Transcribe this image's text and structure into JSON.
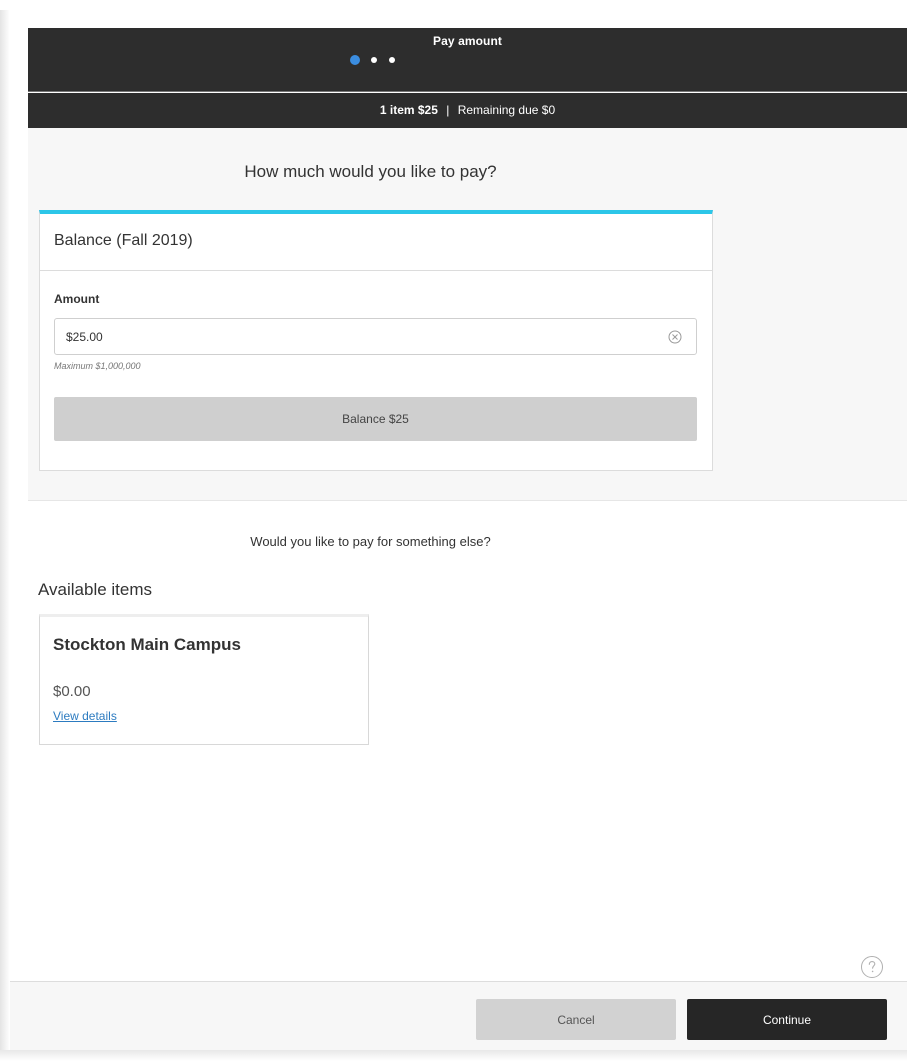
{
  "header": {
    "title": "Pay amount",
    "steps": {
      "current": 1,
      "total": 3
    }
  },
  "summary": {
    "items_bold": "1 item $25",
    "separator": "|",
    "remaining": "Remaining due $0"
  },
  "payment": {
    "question": "How much would you like to pay?",
    "card_title": "Balance (Fall 2019)",
    "amount_label": "Amount",
    "amount_value": "$25.00",
    "maximum_note": "Maximum $1,000,000",
    "balance_button_label": "Balance $25"
  },
  "other": {
    "question": "Would you like to pay for something else?",
    "available_title": "Available items",
    "items": [
      {
        "name": "Stockton Main Campus",
        "price": "$0.00",
        "link_label": "View details"
      }
    ]
  },
  "footer": {
    "cancel_label": "Cancel",
    "continue_label": "Continue"
  },
  "colors": {
    "accent": "#2cc6e8",
    "step_active": "#3b8de0",
    "header_bg": "#2d2d2d",
    "link": "#2c7bc0"
  },
  "icons": {
    "clear": "clear-circle-x-icon",
    "help": "question-circle-icon"
  }
}
